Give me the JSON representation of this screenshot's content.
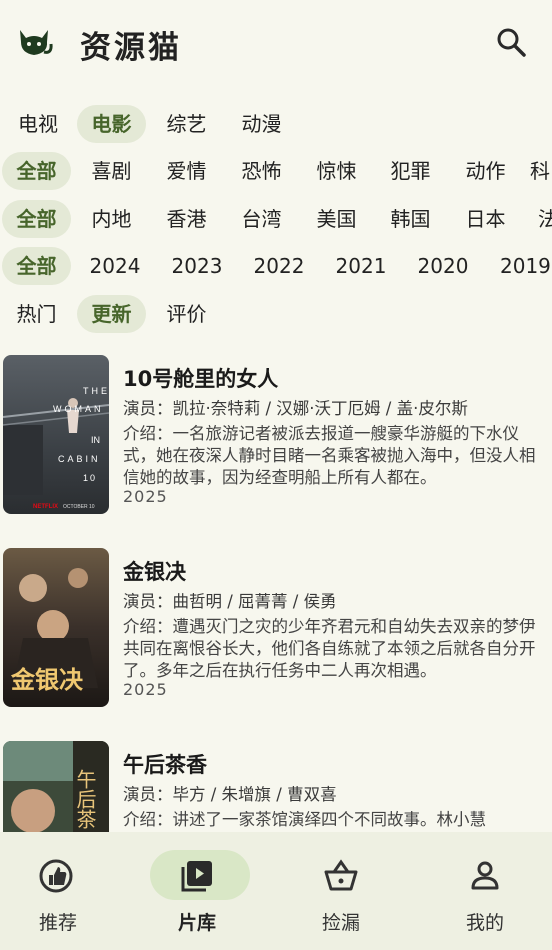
{
  "app": {
    "title": "资源猫"
  },
  "colors": {
    "accent": "#47652b",
    "chip_selected_bg": "#e4e9d6",
    "nav_bg": "#eef0e2",
    "page_bg": "#f7f7ee"
  },
  "icons": {
    "logo": "cat-logo-icon",
    "search": "search-icon"
  },
  "filters": {
    "category": [
      "电视",
      "电影",
      "综艺",
      "动漫"
    ],
    "category_selected": "电影",
    "genre": [
      "全部",
      "喜剧",
      "爱情",
      "恐怖",
      "惊悚",
      "犯罪",
      "动作",
      "科"
    ],
    "genre_selected": "全部",
    "region": [
      "全部",
      "内地",
      "香港",
      "台湾",
      "美国",
      "韩国",
      "日本",
      "法"
    ],
    "region_selected": "全部",
    "year": [
      "全部",
      "2024",
      "2023",
      "2022",
      "2021",
      "2020",
      "2019"
    ],
    "year_selected": "全部",
    "sort": [
      "热门",
      "更新",
      "评价"
    ],
    "sort_selected": "更新"
  },
  "items": [
    {
      "title": "10号舱里的女人",
      "cast": "演员：凯拉·奈特莉 / 汉娜·沃丁厄姆 / 盖·皮尔斯",
      "desc": "介绍：一名旅游记者被派去报道一艘豪华游艇的下水仪式，她在夜深人静时目睹一名乘客被抛入海中，但没人相信她的故事，因为经查明船上所有人都在。",
      "year": "2025",
      "poster": {
        "lines": [
          "THE",
          "WOMAN",
          "IN",
          "CABIN",
          "10"
        ],
        "brand": "NETFLIX",
        "date": "OCTOBER 10"
      }
    },
    {
      "title": "金银决",
      "cast": "演员：曲哲明 / 屈菁菁 / 侯勇",
      "desc": "介绍：遭遇灭门之灾的少年齐君元和自幼失去双亲的梦伊共同在离恨谷长大，他们各自练就了本领之后就各自分开了。多年之后在执行任务中二人再次相遇。",
      "year": "2025",
      "poster": {
        "text": "金银决"
      }
    },
    {
      "title": "午后茶香",
      "cast": "演员：毕方 / 朱增旗 / 曹双喜",
      "desc": "介绍：讲述了一家茶馆演绎四个不同故事。林小慧",
      "year": "",
      "poster": {
        "text": "午后茶"
      }
    }
  ],
  "nav": [
    {
      "label": "推荐",
      "icon": "recommend-icon"
    },
    {
      "label": "片库",
      "icon": "library-icon"
    },
    {
      "label": "捡漏",
      "icon": "basket-icon"
    },
    {
      "label": "我的",
      "icon": "profile-icon"
    }
  ],
  "nav_active": "片库"
}
